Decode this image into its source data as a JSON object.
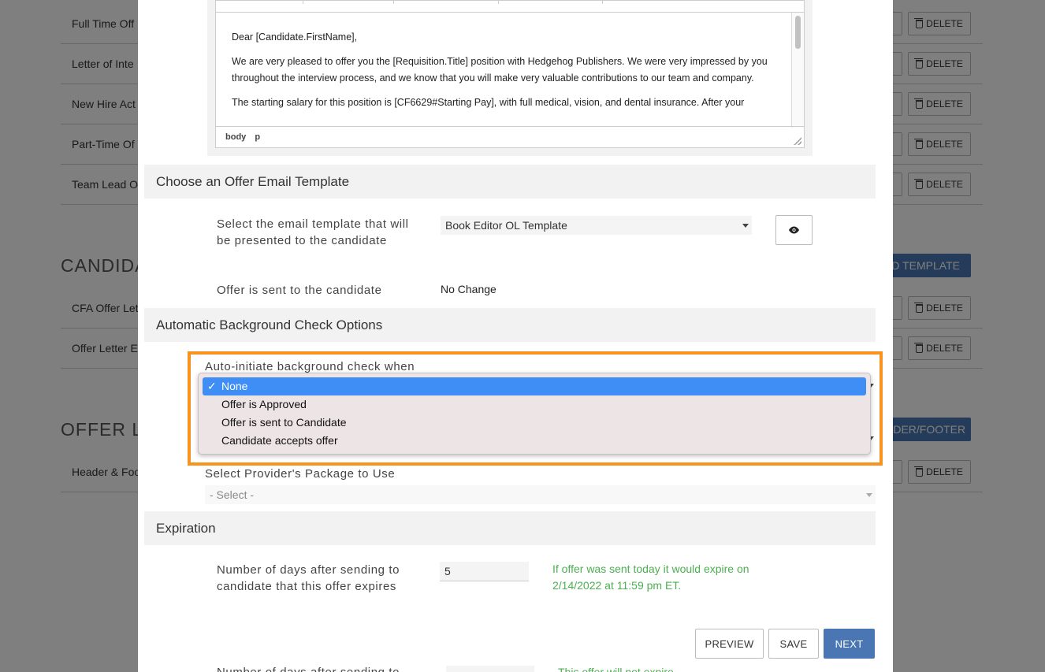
{
  "background": {
    "rows_top": [
      {
        "name": "Full Time Off"
      },
      {
        "name": "Letter of Inte"
      },
      {
        "name": "New Hire Act"
      },
      {
        "name": "Part-Time Of"
      },
      {
        "name": "Team Lead O"
      }
    ],
    "section_candidate": "CANDIDA",
    "add_template_label": "D TEMPLATE",
    "rows_candidate": [
      {
        "name": "CFA Offer Let"
      },
      {
        "name": "Offer Letter E"
      }
    ],
    "section_offer": "OFFER LE",
    "header_footer_btn_label": "ADER/FOOTER",
    "rows_offer": [
      {
        "name": "Header & Foo"
      }
    ],
    "delete_label": "DELETE"
  },
  "editor": {
    "paragraphs": [
      "Dear [Candidate.FirstName],",
      "We are very pleased to offer you the [Requisition.Title] position with Hedgehog Publishers. We were very impressed by you throughout the interview process, and we know that you will make very valuable contributions to our team and company.",
      "The starting salary for this position is [CF6629#Starting Pay], with full medical, vision, and dental insurance. After your"
    ],
    "status_path": [
      "body",
      "p"
    ]
  },
  "email_template": {
    "header": "Choose an Offer Email Template",
    "select_label": "Select the email template that will be presented to the candidate",
    "selected_value": "Book Editor OL Template",
    "preview_icon": "eye-icon",
    "sent_label": "Offer is sent to the candidate",
    "sent_value": "No Change"
  },
  "background_check": {
    "header": "Automatic Background Check Options",
    "auto_label": "Auto-initiate background check when",
    "options": [
      "None",
      "Offer is Approved",
      "Offer is sent to Candidate",
      "Candidate accepts offer"
    ],
    "selected_index": 0,
    "check_mark": "✓",
    "package_label": "Select Provider's Package to Use",
    "package_placeholder": "- Select -"
  },
  "expiration": {
    "header": "Expiration",
    "days_label": "Number of days after sending to candidate that this offer expires",
    "days_value": "5",
    "expire_note": "If offer was sent today it would expire on 2/14/2022 at 11:59 pm ET.",
    "cut_label": "Number of days after sending to",
    "cut_note": "This offer will not expire"
  },
  "actions": {
    "preview": "PREVIEW",
    "save": "SAVE",
    "next": "NEXT"
  },
  "colors": {
    "primary": "#4a77b4",
    "highlight": "#f7931e",
    "selected_option": "#3f8ef5",
    "note_green": "#4caf50"
  }
}
